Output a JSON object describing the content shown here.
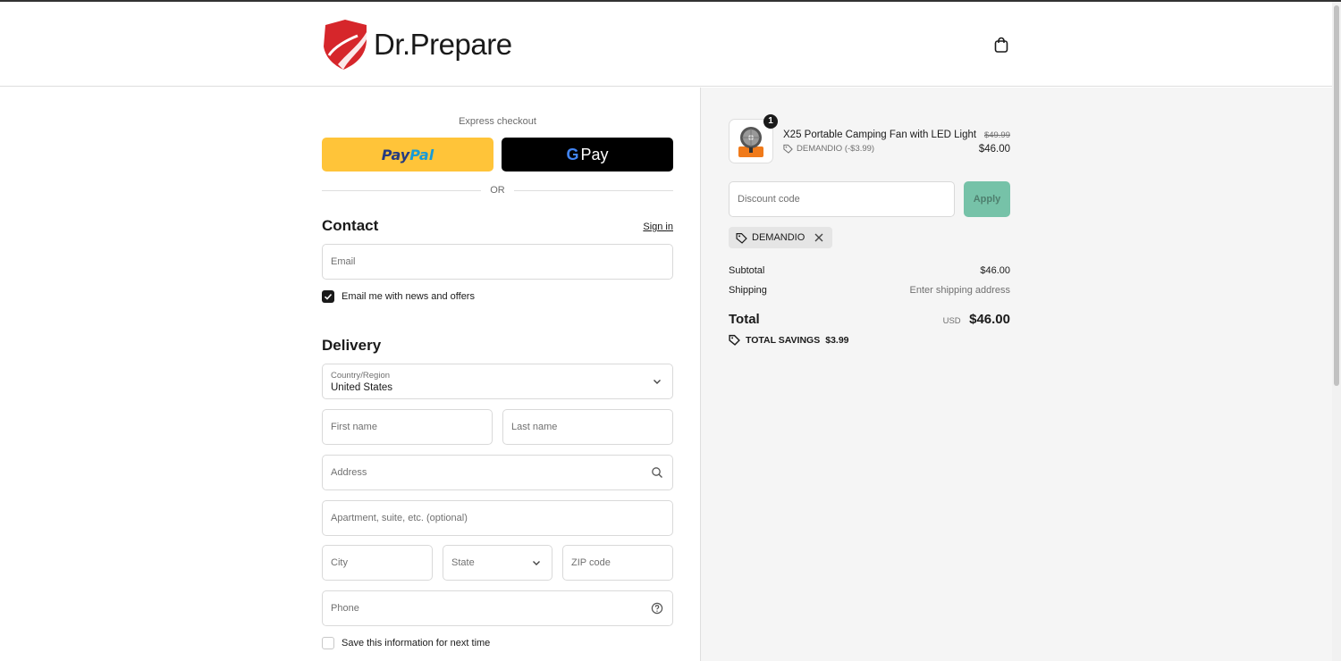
{
  "brand": {
    "name": "Dr.Prepare",
    "accent": "#d6262b"
  },
  "header": {
    "cart_icon": "shopping-bag-icon"
  },
  "express": {
    "label": "Express checkout",
    "paypal_part1": "Pay",
    "paypal_part2": "Pal",
    "gpay_g": "G",
    "gpay_label": "Pay",
    "or_text": "OR"
  },
  "contact": {
    "title": "Contact",
    "signin": "Sign in",
    "email_placeholder": "Email",
    "news_label": "Email me with news and offers",
    "news_checked": true
  },
  "delivery": {
    "title": "Delivery",
    "country_label": "Country/Region",
    "country_value": "United States",
    "first_name": "First name",
    "last_name": "Last name",
    "address": "Address",
    "apartment": "Apartment, suite, etc. (optional)",
    "city": "City",
    "state": "State",
    "zip": "ZIP code",
    "phone": "Phone",
    "save_label": "Save this information for next time",
    "save_checked": false
  },
  "summary": {
    "product": {
      "quantity": "1",
      "name": "X25 Portable Camping Fan with LED Light",
      "discount": "DEMANDIO (-$3.99)",
      "old_price": "$49.99",
      "price": "$46.00"
    },
    "discount_placeholder": "Discount code",
    "apply_label": "Apply",
    "applied_code": "DEMANDIO",
    "subtotal_label": "Subtotal",
    "subtotal_value": "$46.00",
    "shipping_label": "Shipping",
    "shipping_value": "Enter shipping address",
    "total_label": "Total",
    "currency": "USD",
    "total_value": "$46.00",
    "savings_label": "TOTAL SAVINGS",
    "savings_value": "$3.99"
  }
}
